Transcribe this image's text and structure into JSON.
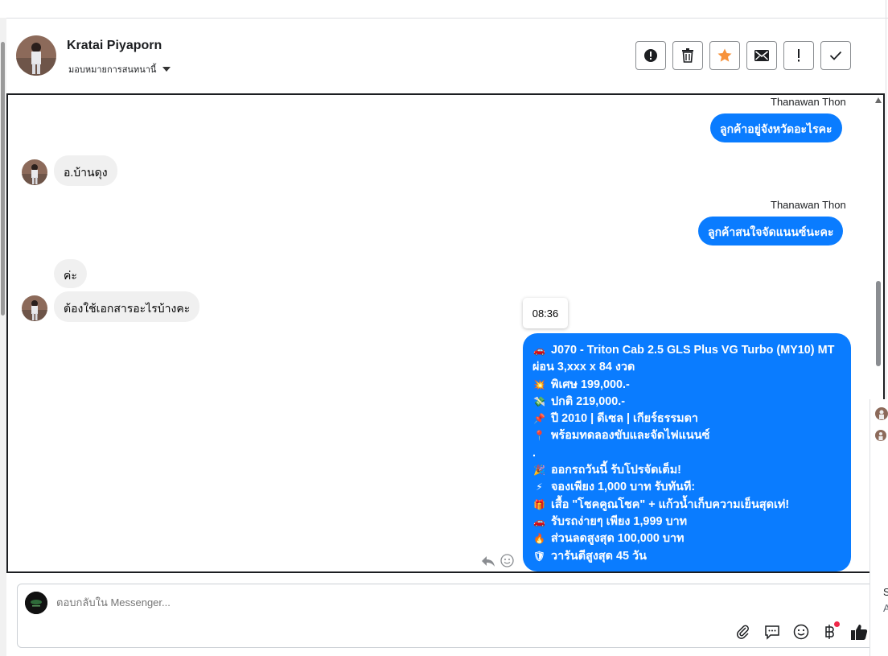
{
  "header": {
    "contact_name": "Kratai Piyaporn",
    "assign_label": "มอบหมายการสนทนานี้",
    "actions": [
      {
        "name": "report-spam-icon",
        "label": "!"
      },
      {
        "name": "trash-icon",
        "label": ""
      },
      {
        "name": "star-icon",
        "label": ""
      },
      {
        "name": "envelope-icon",
        "label": ""
      },
      {
        "name": "exclamation-icon",
        "label": "!"
      },
      {
        "name": "check-icon",
        "label": ""
      }
    ]
  },
  "messages": {
    "out1": {
      "sender": "Thanawan Thon",
      "text": "ลูกค้าอยู่จังหวัดอะไรคะ"
    },
    "in1": {
      "text": "อ.บ้านดุง"
    },
    "out2": {
      "sender": "Thanawan Thon",
      "text": "ลูกค้าสนใจจัดแนนซ์นะคะ"
    },
    "in2": {
      "text": "ค่ะ"
    },
    "in3": {
      "text": "ต้องใช้เอกสารอะไรบ้างคะ"
    },
    "timestamp": "08:36",
    "promo": {
      "lines": [
        {
          "icon": "car-icon",
          "glyph": "🚗",
          "text": "J070 - Triton Cab 2.5 GLS Plus VG Turbo (MY10) MT"
        },
        {
          "icon": "",
          "glyph": "",
          "text": "ผ่อน 3,xxx x 84 งวด"
        },
        {
          "icon": "explosion-icon",
          "glyph": "💥",
          "text": "พิเศษ 199,000.-"
        },
        {
          "icon": "money-wings-icon",
          "glyph": "💸",
          "text": "ปกติ 219,000.-"
        },
        {
          "icon": "pushpin-icon",
          "glyph": "📌",
          "text": "ปี 2010 | ดีเซล | เกียร์ธรรมดา"
        },
        {
          "icon": "round-pushpin-icon",
          "glyph": "📍",
          "text": "พร้อมทดลองขับและจัดไฟแนนซ์"
        },
        {
          "icon": "",
          "glyph": "",
          "text": "."
        },
        {
          "icon": "party-popper-icon",
          "glyph": "🎉",
          "text": "ออกรถวันนี้ รับโปรจัดเต็ม!"
        },
        {
          "icon": "lightning-icon",
          "glyph": "⚡",
          "text": "จองเพียง 1,000 บาท รับทันที:"
        },
        {
          "icon": "gift-icon",
          "glyph": "🎁",
          "text": "เสื้อ \"โชคคูณโชค\" + แก้วน้ำเก็บความเย็นสุดเท่!"
        },
        {
          "icon": "car-icon",
          "glyph": "🚗",
          "text": "รับรถง่ายๆ เพียง 1,999 บาท"
        },
        {
          "icon": "fire-icon",
          "glyph": "🔥",
          "text": "ส่วนลดสูงสุด 100,000 บาท"
        },
        {
          "icon": "shield-icon",
          "glyph": "🛡",
          "text": "วารันตีสูงสุด 45 วัน"
        }
      ]
    }
  },
  "composer": {
    "placeholder": "ตอบกลับใน Messenger..."
  },
  "side_peek": {
    "letter1": "S",
    "letter2": "A"
  },
  "colors": {
    "bubble_out": "#0a7cff",
    "bubble_in": "#f0f0f0",
    "star": "#f7923b"
  }
}
